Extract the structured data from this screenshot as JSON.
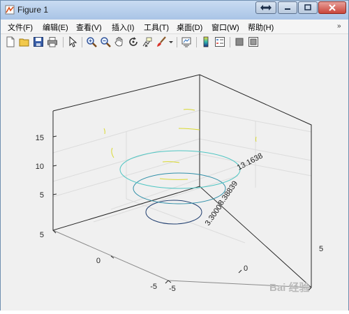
{
  "window": {
    "title": "Figure 1"
  },
  "menu": {
    "items": [
      "文件(F)",
      "编辑(E)",
      "查看(V)",
      "插入(I)",
      "工具(T)",
      "桌面(D)",
      "窗口(W)",
      "帮助(H)"
    ],
    "overflow_arrow": "»"
  },
  "toolbar": {
    "icons": [
      "new-figure-icon",
      "open-file-icon",
      "save-icon",
      "print-icon",
      "pointer-icon",
      "zoom-in-icon",
      "zoom-out-icon",
      "pan-hand-icon",
      "rotate-3d-icon",
      "data-cursor-icon",
      "brush-icon",
      "link-plot-icon",
      "colorbar-icon",
      "legend-icon",
      "hide-plot-tools-icon",
      "show-plot-tools-icon"
    ]
  },
  "chart_data": {
    "type": "contour3",
    "title": "",
    "xlabel": "",
    "ylabel": "",
    "zlabel": "",
    "xlim": [
      -5,
      5
    ],
    "ylim": [
      -5,
      5
    ],
    "zlim": [
      0,
      20
    ],
    "x_ticks": [
      "-5",
      "0",
      "5"
    ],
    "y_ticks": [
      "-5",
      "0",
      "5"
    ],
    "z_ticks": [
      "5",
      "10",
      "15"
    ],
    "grid": true,
    "contour_levels": [
      {
        "level": 3.3,
        "label": "3.3000"
      },
      {
        "level": 8.38839,
        "label": "8.38839"
      },
      {
        "level": 13.1638,
        "label": "13.1638"
      }
    ],
    "colors": {
      "low": "#1f3d6e",
      "mid": "#3fb8c0",
      "high": "#d9d930"
    }
  },
  "watermark": {
    "text": "Bai 经验"
  }
}
